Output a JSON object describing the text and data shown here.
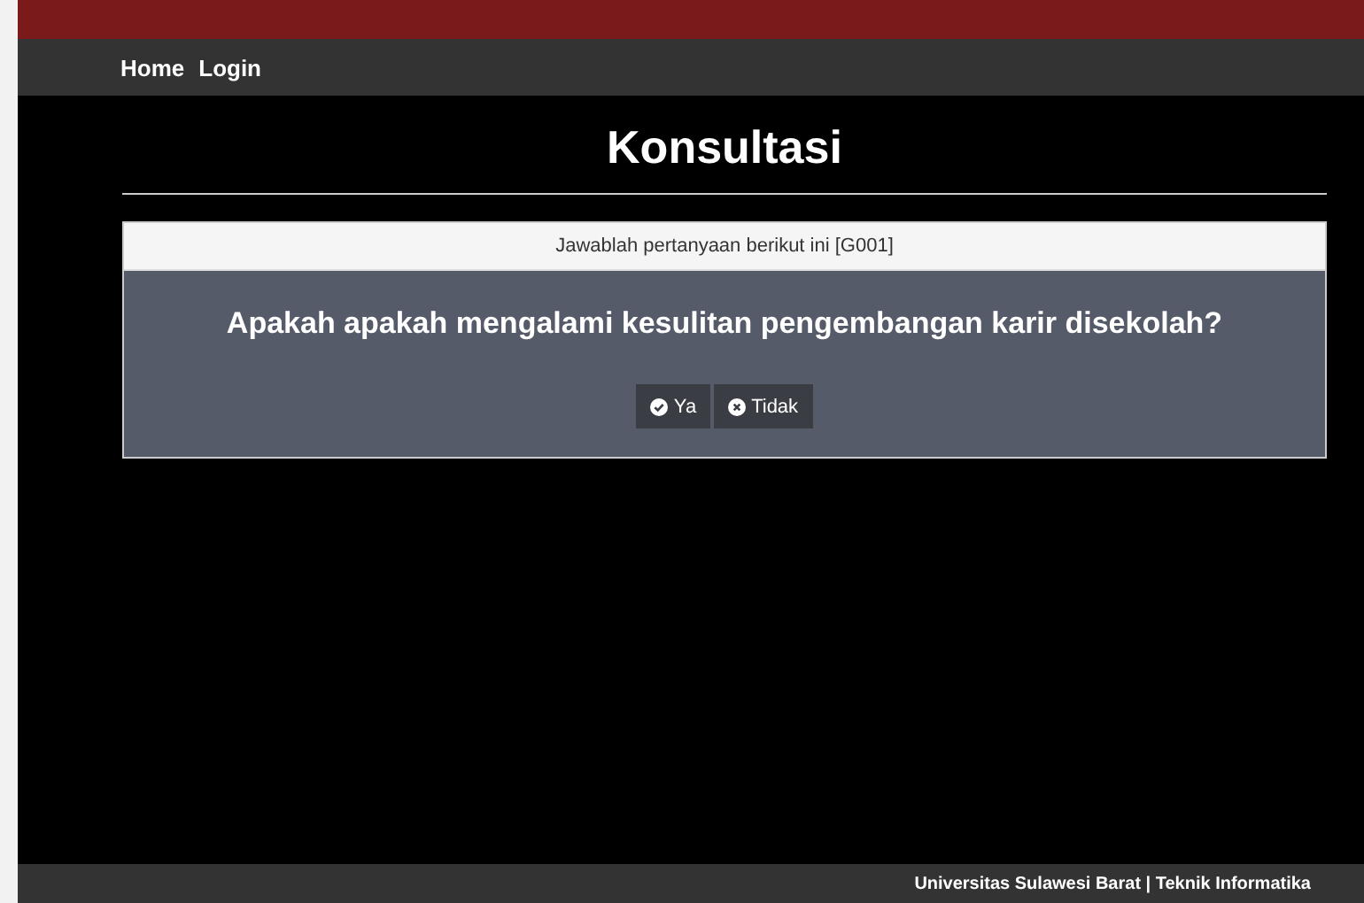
{
  "nav": {
    "items": [
      {
        "label": "Home"
      },
      {
        "label": "Login"
      }
    ]
  },
  "page": {
    "title": "Konsultasi"
  },
  "panel": {
    "header": "Jawablah pertanyaan berikut ini [G001]",
    "question": "Apakah apakah mengalami kesulitan pengembangan karir disekolah?",
    "buttons": [
      {
        "label": "Ya",
        "kind": "yes"
      },
      {
        "label": "Tidak",
        "kind": "no"
      }
    ]
  },
  "footer": {
    "text": "Universitas Sulawesi Barat | Teknik Informatika"
  }
}
